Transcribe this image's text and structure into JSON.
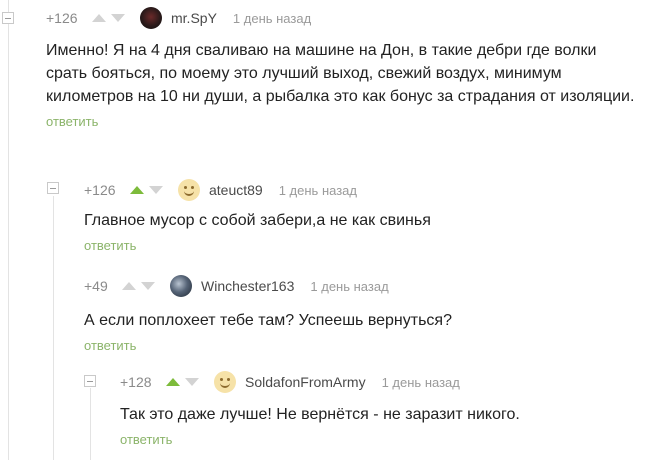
{
  "comments": [
    {
      "rating": "+126",
      "username": "mr.SpY",
      "time": "1 день назад",
      "text": "Именно! Я на 4 дня сваливаю на машине на Дон, в такие дебри где волки срать бояться, по моему это лучший выход, свежий воздух, минимум километров на 10 ни души, а рыбалка это как бонус за страдания от изоляции.",
      "reply": "ответить"
    },
    {
      "rating": "+126",
      "username": "ateuct89",
      "time": "1 день назад",
      "text": "Главное мусор с собой забери,а не как свинья",
      "reply": "ответить"
    },
    {
      "rating": "+49",
      "username": "Winchester163",
      "time": "1 день назад",
      "text": "А если поплохеет тебе там? Успеешь вернуться?",
      "reply": "ответить"
    },
    {
      "rating": "+128",
      "username": "SoldafonFromArmy",
      "time": "1 день назад",
      "text": "Так это даже лучше! Не вернётся - не заразит никого.",
      "reply": "ответить"
    }
  ]
}
